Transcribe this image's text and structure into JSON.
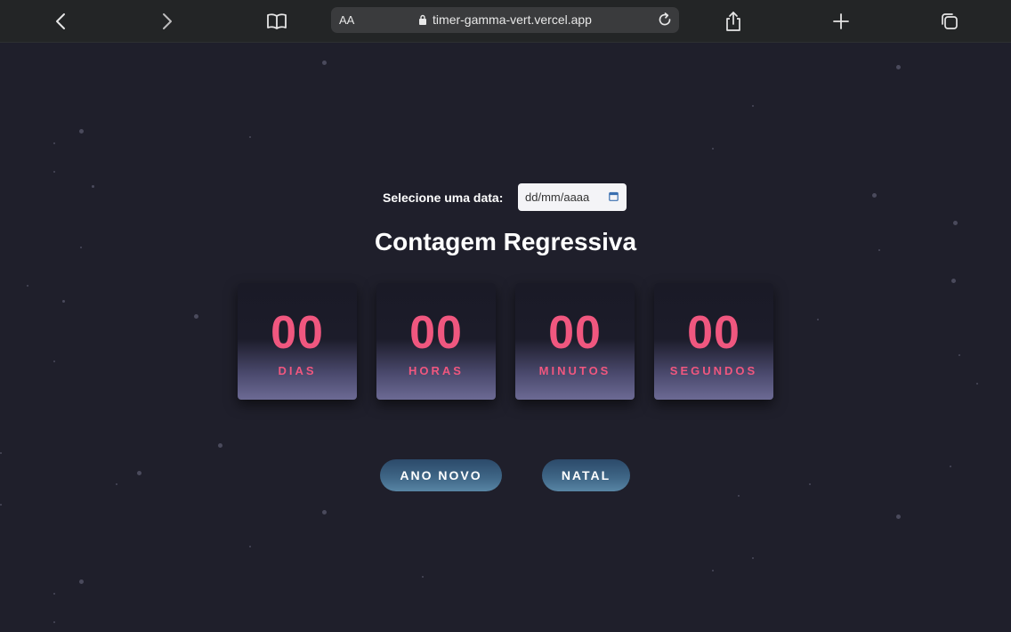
{
  "browser": {
    "text_size_label": "AA",
    "url": "timer-gamma-vert.vercel.app",
    "icons": [
      "back-icon",
      "forward-icon",
      "reader-book-icon",
      "lock-icon",
      "reload-icon",
      "share-icon",
      "new-tab-plus-icon",
      "tabs-icon"
    ]
  },
  "date_picker": {
    "label": "Selecione uma data:",
    "placeholder": "dd/mm/aaaa",
    "icon": "calendar-icon"
  },
  "title": "Contagem Regressiva",
  "countdown": [
    {
      "value": "00",
      "label": "DIAS"
    },
    {
      "value": "00",
      "label": "HORAS"
    },
    {
      "value": "00",
      "label": "MINUTOS"
    },
    {
      "value": "00",
      "label": "SEGUNDOS"
    }
  ],
  "buttons": {
    "new_year": "ANO NOVO",
    "christmas": "NATAL"
  },
  "colors": {
    "background": "#1f1f2b",
    "accent": "#f0577f",
    "button": "#3e6585",
    "toolbar": "#232526"
  }
}
